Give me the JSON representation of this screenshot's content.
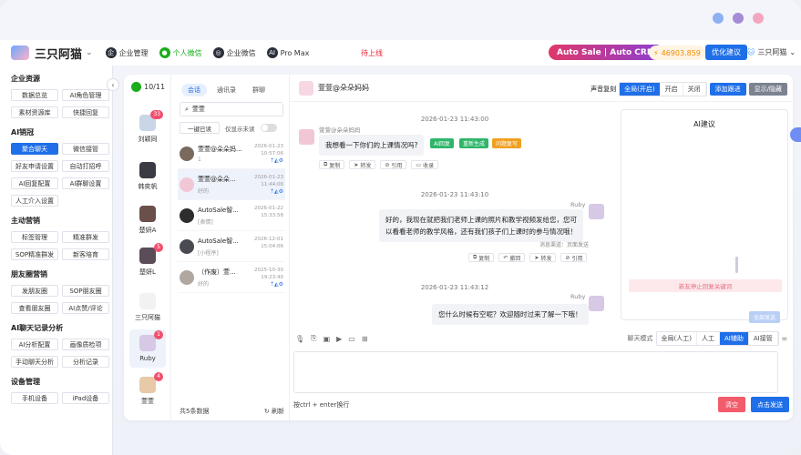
{
  "window": {
    "dot_colors": [
      "#8fb0f2",
      "#a78bd6",
      "#f3a6bf"
    ]
  },
  "topbar": {
    "app_name": "三只阿猫",
    "nav": [
      {
        "label": "企业管理",
        "icon": "enterprise-icon"
      },
      {
        "label": "个人微信",
        "icon": "wechat-icon"
      },
      {
        "label": "企业微信",
        "icon": "wecom-icon"
      },
      {
        "label": "Pro Max",
        "icon": "ai-icon"
      }
    ],
    "go_live": "待上线",
    "crm_banner": "Auto Sale | Auto CRM",
    "points": "46903.859",
    "optimize_button": "优化建议",
    "user_name": "三只阿猫"
  },
  "sidebar": {
    "sections": [
      {
        "title": "企业资源",
        "items": [
          "数据总览",
          "AI角色管理",
          "素材资源库",
          "快捷回复"
        ]
      },
      {
        "title": "AI销冠",
        "items": [
          "聚合聊天",
          "微信接管",
          "好友申请设置",
          "自动打招呼",
          "AI回复配置",
          "AI群聊设置",
          "人工介入设置"
        ]
      },
      {
        "title": "主动营销",
        "items": [
          "标签管理",
          "精准群发",
          "SOP精准群发",
          "新客培育"
        ]
      },
      {
        "title": "朋友圈营销",
        "items": [
          "发朋友圈",
          "SOP朋友圈",
          "查看朋友圈",
          "AI点赞/评论"
        ]
      },
      {
        "title": "AI聊天记录分析",
        "items": [
          "AI分析配置",
          "画像质检项",
          "手动聊天分析",
          "分析记录"
        ]
      },
      {
        "title": "设备管理",
        "items": [
          "手机设备",
          "iPad设备"
        ]
      }
    ],
    "selected": "聚合聊天"
  },
  "accounts": {
    "count": "10/11",
    "items": [
      {
        "name": "刘颖同",
        "badge": "33",
        "color": "#c9d6e8"
      },
      {
        "name": "韩奕帆",
        "badge": "",
        "color": "#3b3b45"
      },
      {
        "name": "楚妍A",
        "badge": "",
        "color": "#6b4f4a"
      },
      {
        "name": "楚妍L",
        "badge": "5",
        "color": "#5b4d58"
      },
      {
        "name": "三只阿猫",
        "badge": "",
        "color": "#f2f2f2"
      },
      {
        "name": "Ruby",
        "badge": "1",
        "color": "#d7c8e6"
      },
      {
        "name": "萱萱",
        "badge": "4",
        "color": "#e8c9a8"
      }
    ],
    "selected": "Ruby"
  },
  "contacts": {
    "tabs": [
      "会话",
      "通讯录",
      "群聊"
    ],
    "search_value": "萱萱",
    "read_all": "一键已读",
    "show_unread_only": "仅显示未读",
    "items": [
      {
        "name": "萱萱@朵朵妈...",
        "msg": "1",
        "date": "2026-01-23",
        "time": "10:57:06",
        "color": "#7a6a5e"
      },
      {
        "name": "萱萱@朵朵...",
        "msg": "好的",
        "date": "2026-01-23",
        "time": "11:44:06",
        "color": "#f2c7d5"
      },
      {
        "name": "AutoSale智...",
        "msg": "[表情]",
        "date": "2026-01-22",
        "time": "15:33:58",
        "color": "#2d2d2d"
      },
      {
        "name": "AutoSale智...",
        "msg": "[小程序]",
        "date": "2026-12-01",
        "time": "15:04:06",
        "color": "#4a4a52"
      },
      {
        "name": "（作废）萱...",
        "msg": "好的",
        "date": "2025-10-30",
        "time": "19:23:40",
        "color": "#b0a7a0"
      }
    ],
    "total": "共5条数据",
    "refresh": "刷新"
  },
  "chat": {
    "title": "萱萱@朵朵妈妈",
    "voice_copy": "声音复刻",
    "voice_modes": [
      "全局(开启)",
      "开启",
      "关闭"
    ],
    "add_tag": "添加跟进",
    "toggle_show": "显示/隐藏",
    "messages": [
      {
        "time": "2026-01-23 11:43:00",
        "sender": "萱萱@朵朵妈妈",
        "text": "我想看一下你们的上课情况吗?",
        "tags": [
          "AI回复",
          "重新生成",
          "问题复写"
        ],
        "actions": [
          "复制",
          "转发",
          "引用",
          "收录"
        ]
      },
      {
        "time": "2026-01-23 11:43:10",
        "sender": "Ruby",
        "text_lines": [
          "好的，我现在就把我们老师上课的照片和教学视频发给您，您可",
          "以看看老师的教学风格，还有我们孩子们上课时的参与情况哦！"
        ],
        "source": "消息渠道：页面发送",
        "actions": [
          "复制",
          "撤回",
          "转发",
          "引用"
        ]
      },
      {
        "time": "2026-01-23 11:43:12",
        "sender": "Ruby",
        "text": "您什么时候有空呢？欢迎随时过来了解一下哦！"
      }
    ],
    "ai_panel": {
      "title": "AI建议",
      "warning": "新友停止回复关键词",
      "send": "全部发送"
    },
    "chat_mode_label": "聊天模式",
    "chat_modes": [
      "全局(人工)",
      "人工",
      "AI辅助",
      "AI接管"
    ],
    "chat_mode_selected": "AI辅助",
    "input_hint": "按ctrl + enter换行",
    "clear_button": "清空",
    "send_button": "点击发送"
  }
}
